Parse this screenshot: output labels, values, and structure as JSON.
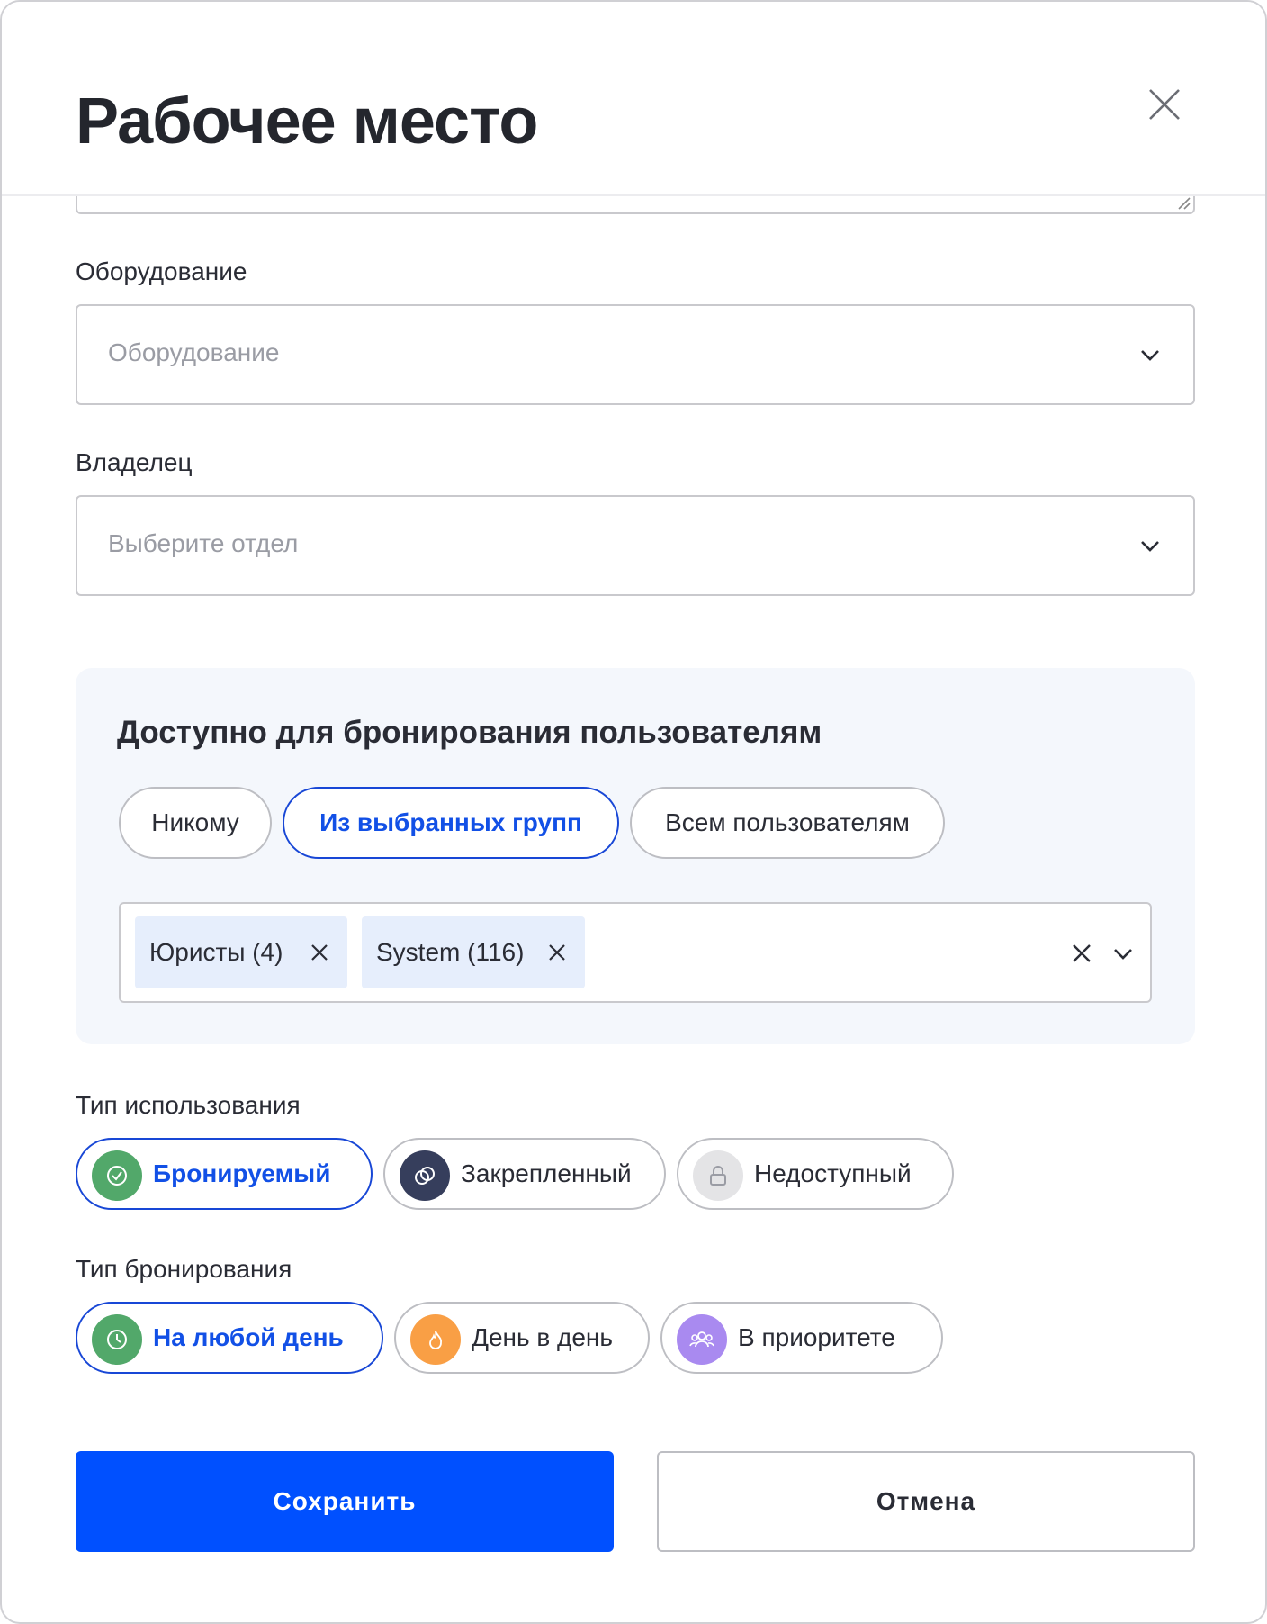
{
  "dialog": {
    "title": "Рабочее место"
  },
  "equipment": {
    "label": "Оборудование",
    "placeholder": "Оборудование"
  },
  "owner": {
    "label": "Владелец",
    "placeholder": "Выберите отдел"
  },
  "booking_access": {
    "title": "Доступно для бронирования пользователям",
    "options": [
      {
        "label": "Никому",
        "active": false
      },
      {
        "label": "Из выбранных групп",
        "active": true
      },
      {
        "label": "Всем пользователям",
        "active": false
      }
    ],
    "selected_groups": [
      {
        "label": "Юристы (4)"
      },
      {
        "label": "System (116)"
      }
    ]
  },
  "usage_type": {
    "label": "Тип использования",
    "options": [
      {
        "label": "Бронируемый",
        "active": true,
        "icon": "check-circle-icon",
        "color": "#52a86a"
      },
      {
        "label": "Закрепленный",
        "active": false,
        "icon": "pin-icon",
        "color": "#363e5c"
      },
      {
        "label": "Недоступный",
        "active": false,
        "icon": "lock-icon",
        "color": "#e4e4e6"
      }
    ]
  },
  "booking_type": {
    "label": "Тип бронирования",
    "options": [
      {
        "label": "На любой день",
        "active": true,
        "icon": "clock-icon",
        "color": "#52a86a"
      },
      {
        "label": "День в день",
        "active": false,
        "icon": "fire-icon",
        "color": "#f99f45"
      },
      {
        "label": "В приоритете",
        "active": false,
        "icon": "group-icon",
        "color": "#a98af0"
      }
    ]
  },
  "actions": {
    "save_label": "Сохранить",
    "cancel_label": "Отмена"
  },
  "colors": {
    "primary": "#0050ff",
    "active_border": "#1847d6",
    "panel_bg": "#f4f7fc",
    "tag_bg": "#e6eefc"
  }
}
